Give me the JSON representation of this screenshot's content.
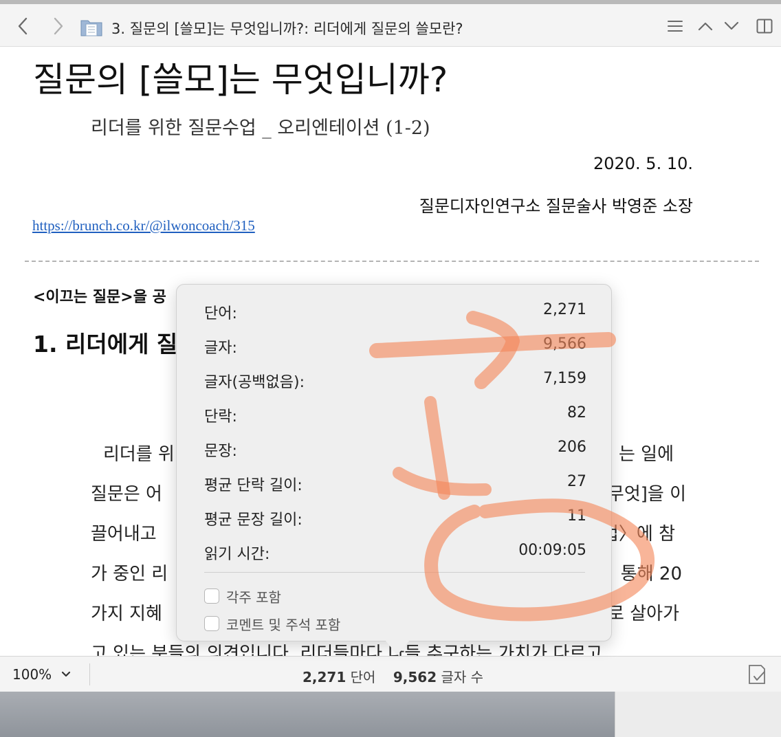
{
  "window": {
    "title": "3. 질문의 [쓸모]는 무엇입니까?: 리더에게 질문의 쓸모란?"
  },
  "document": {
    "title": "질문의 [쓸모]는 무엇입니까?",
    "subtitle": "리더를 위한 질문수업 _ 오리엔테이션 (1-2)",
    "date": "2020. 5. 10.",
    "author": "질문디자인연구소 질문술사 박영준 소장",
    "link": "https://brunch.co.kr/@ilwoncoach/315",
    "lead_text": "<이끄는 질문>을 공",
    "heading": "1. 리더에게 질",
    "body_left": [
      "리더를 위",
      "질문은 어",
      "끌어내고 ",
      "가 중인 리",
      "가지 지혜"
    ],
    "body_right": [
      "는 일에",
      "무엇]을 이",
      "업〉에 참",
      "통해 20",
      "로 살아가"
    ],
    "body_bottom": "고 있는 분들의 의견입니다. 리더들마다 다들 추구하는 가치가 다르고"
  },
  "stats": {
    "rows": [
      {
        "label": "단어:",
        "value": "2,271"
      },
      {
        "label": "글자:",
        "value": "9,566"
      },
      {
        "label": "글자(공백없음):",
        "value": "7,159"
      },
      {
        "label": "단락:",
        "value": "82"
      },
      {
        "label": "문장:",
        "value": "206"
      },
      {
        "label": "평균 단락 길이:",
        "value": "27"
      },
      {
        "label": "평균 문장 길이:",
        "value": "11"
      },
      {
        "label": "읽기 시간:",
        "value": "00:09:05"
      }
    ],
    "include_footnotes": "각주 포함",
    "include_comments": "코멘트 및 주석 포함"
  },
  "statusbar": {
    "zoom": "100%",
    "word_count": "2,271",
    "word_unit": "단어",
    "char_count": "9,562",
    "char_unit": "글자 수"
  },
  "colors": {
    "accent_link": "#1f5fbf",
    "annotation": "#f4875a"
  },
  "icons": {
    "back": "chevron-left-icon",
    "forward": "chevron-right-icon",
    "document": "document-folder-icon",
    "list": "list-icon",
    "prev": "chevron-up-icon",
    "next": "chevron-down-icon",
    "sidebar": "sidebar-icon",
    "track_changes": "track-changes-icon"
  }
}
